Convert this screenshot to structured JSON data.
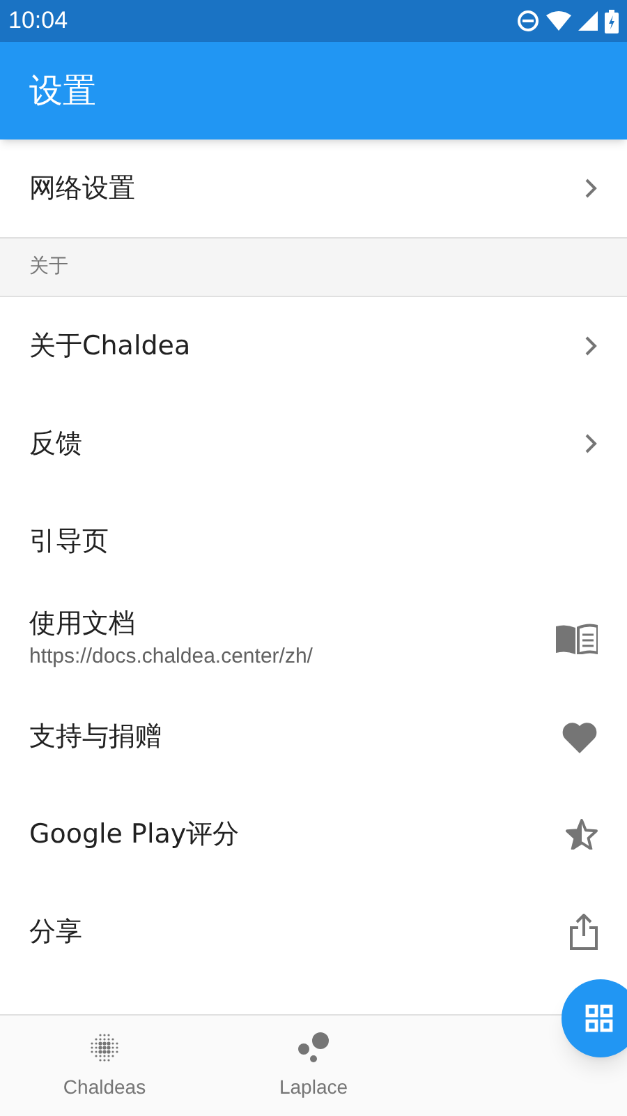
{
  "status_bar": {
    "time": "10:04"
  },
  "app_bar": {
    "title": "设置"
  },
  "sections": [
    {
      "items": [
        {
          "title": "网络设置",
          "kind": "chevron"
        }
      ]
    },
    {
      "header": "关于",
      "items": [
        {
          "title": "关于Chaldea",
          "kind": "chevron"
        },
        {
          "title": "反馈",
          "kind": "chevron"
        },
        {
          "title": "引导页",
          "kind": "plain"
        },
        {
          "title": "使用文档",
          "subtitle": "https://docs.chaldea.center/zh/",
          "kind": "book"
        },
        {
          "title": "支持与捐赠",
          "kind": "heart"
        },
        {
          "title": "Google Play评分",
          "kind": "star"
        },
        {
          "title": "分享",
          "kind": "share"
        }
      ]
    }
  ],
  "bottom_nav": [
    {
      "label": "Chaldeas",
      "kind": "dots",
      "selected": false
    },
    {
      "label": "Laplace",
      "kind": "bubbles",
      "selected": false
    }
  ]
}
